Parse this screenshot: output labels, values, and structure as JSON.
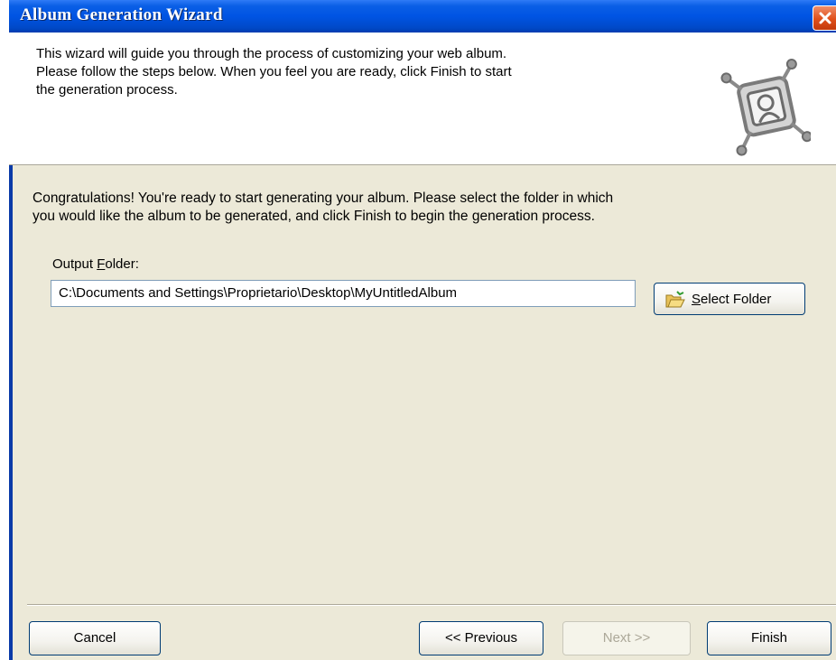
{
  "window": {
    "title": "Album Generation Wizard"
  },
  "header": {
    "description_lines": [
      "This wizard will guide you through the process of customizing your web album.",
      "Please follow the steps below. When you feel you are ready, click Finish to start",
      "the generation process."
    ]
  },
  "main": {
    "message_lines": [
      "Congratulations! You're ready to start generating your album. Please select the folder in which",
      "you would like the album to be generated, and click Finish to begin the generation process."
    ],
    "output_folder": {
      "label_prefix": "Output ",
      "label_mnemonic": "F",
      "label_suffix": "older:",
      "value": "C:\\Documents and Settings\\Proprietario\\Desktop\\MyUntitledAlbum"
    },
    "select_folder_button": {
      "mnemonic": "S",
      "label_rest": "elect Folder",
      "icon": "open-folder-icon"
    }
  },
  "footer": {
    "cancel_label": "Cancel",
    "previous_label": "<< Previous",
    "next_label": "Next >>",
    "next_enabled": false,
    "finish_label": "Finish"
  },
  "colors": {
    "title_bar": "#0054e3",
    "dialog_background": "#ece9d8",
    "close_button": "#e04f1a",
    "button_border": "#003c74",
    "disabled_text": "#aca899"
  }
}
